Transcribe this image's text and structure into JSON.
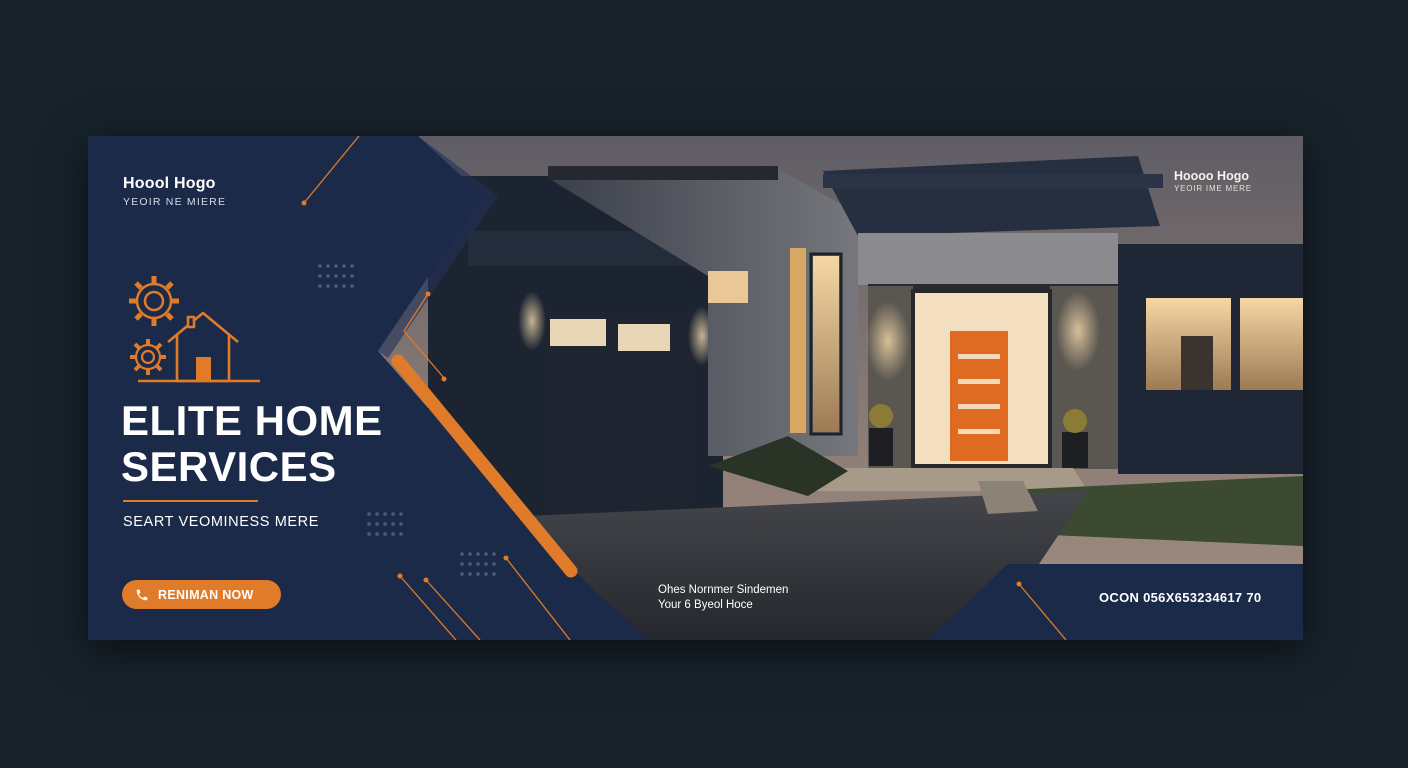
{
  "brand": {
    "logo_title": "Hoool Hogo",
    "logo_subtitle": "YEOIR NE MIERE",
    "secondary_logo_title": "Hoooo Hogo",
    "secondary_logo_subtitle": "YEOIR IME MERE"
  },
  "hero": {
    "headline_line1": "ELITE HOME",
    "headline_line2": "SERVICES",
    "tagline": "SEART VEOMINESS MERE"
  },
  "cta": {
    "label": "RENIMAN NOW",
    "icon": "phone-icon"
  },
  "footer": {
    "info_line1": "Ohes Nornmer Sindemen",
    "info_line2": "Your 6 Byeol Hoce",
    "phone": "OCON 056X653234617 70"
  },
  "colors": {
    "accent": "#e07b2a",
    "navy": "#1b2a48",
    "page_background": "#17222a",
    "text": "#ffffff"
  },
  "icons": [
    "gear-icon",
    "house-icon",
    "phone-icon",
    "dot-grid-icon"
  ]
}
